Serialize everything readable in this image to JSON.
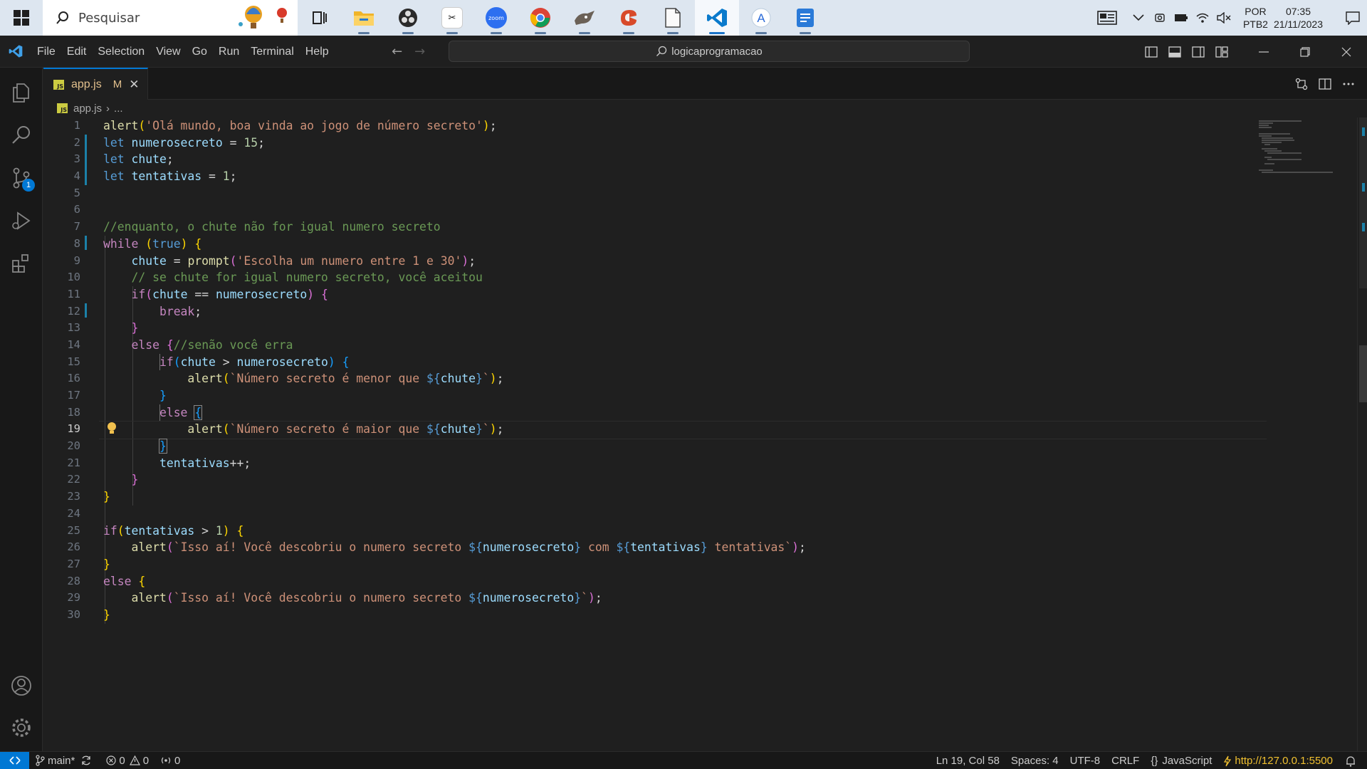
{
  "taskbar": {
    "search_placeholder": "Pesquisar",
    "apps": [
      {
        "name": "task-view",
        "running": false
      },
      {
        "name": "file-explorer",
        "running": true
      },
      {
        "name": "obs",
        "running": true
      },
      {
        "name": "capcut",
        "running": true
      },
      {
        "name": "zoom",
        "label": "zoom",
        "running": true
      },
      {
        "name": "chrome",
        "running": true
      },
      {
        "name": "gimp",
        "running": true
      },
      {
        "name": "scratch",
        "running": true
      },
      {
        "name": "notepad",
        "running": true
      },
      {
        "name": "vscode",
        "running": true,
        "active": true
      },
      {
        "name": "app-a",
        "running": true
      },
      {
        "name": "app-blue",
        "running": true
      }
    ],
    "tray": {
      "lang_line1": "POR",
      "lang_line2": "PTB2",
      "time": "07:35",
      "date": "21/11/2023"
    }
  },
  "titlebar": {
    "menus": [
      "File",
      "Edit",
      "Selection",
      "View",
      "Go",
      "Run",
      "Terminal",
      "Help"
    ],
    "command_center": "logicaprogramacao"
  },
  "activitybar": {
    "scm_badge": "1"
  },
  "tab": {
    "filename": "app.js",
    "status": "M",
    "icon_label": "JS"
  },
  "breadcrumb": {
    "file": "app.js",
    "more": "..."
  },
  "editor": {
    "current_line": 19,
    "line_numbers": [
      "1",
      "2",
      "3",
      "4",
      "5",
      "6",
      "7",
      "8",
      "9",
      "10",
      "11",
      "12",
      "13",
      "14",
      "15",
      "16",
      "17",
      "18",
      "19",
      "20",
      "21",
      "22",
      "23",
      "24",
      "25",
      "26",
      "27",
      "28",
      "29",
      "30"
    ],
    "tokens": {
      "l1_f": "alert",
      "l1_s": "'Olá mundo, boa vinda ao jogo de número secreto'",
      "l2_k": "let",
      "l2_v": "numerosecreto",
      "l2_n": "15",
      "l3_k": "let",
      "l3_v": "chute",
      "l4_k": "let",
      "l4_v": "tentativas",
      "l4_n": "1",
      "l7_c": "//enquanto, o chute não for igual numero secreto",
      "l8_k": "while",
      "l8_t": "true",
      "l9_v": "chute",
      "l9_f": "prompt",
      "l9_s": "'Escolha um numero entre 1 e 30'",
      "l10_c": "// se chute for igual numero secreto, você aceitou",
      "l11_k": "if",
      "l11_v1": "chute",
      "l11_v2": "numerosecreto",
      "l12_k": "break",
      "l14_k": "else",
      "l14_c": "//senão você erra",
      "l15_k": "if",
      "l15_v1": "chute",
      "l15_v2": "numerosecreto",
      "l16_f": "alert",
      "l16_s": "`Número secreto é menor que ",
      "l16_v": "chute",
      "l18_k": "else",
      "l19_f": "alert",
      "l19_s": "`Número secreto é maior que ",
      "l19_v": "chute",
      "l21_v": "tentativas",
      "l25_k": "if",
      "l25_v": "tentativas",
      "l25_n": "1",
      "l26_f": "alert",
      "l26_s1": "`Isso aí! Você descobriu o numero secreto ",
      "l26_v1": "numerosecreto",
      "l26_s2": " com ",
      "l26_v2": "tentativas",
      "l26_s3": " tentativas`",
      "l28_k": "else",
      "l29_f": "alert",
      "l29_s": "`Isso aí! Você descobriu o numero secreto ",
      "l29_v": "numerosecreto"
    }
  },
  "statusbar": {
    "branch": "main*",
    "errors": "0",
    "warnings": "0",
    "ports": "0",
    "cursor": "Ln 19, Col 58",
    "spaces": "Spaces: 4",
    "encoding": "UTF-8",
    "eol": "CRLF",
    "language": "JavaScript",
    "live_server": "http://127.0.0.1:5500"
  },
  "colors": {
    "accent": "#0078d4",
    "keyword": "#569cd6",
    "control": "#c586c0",
    "function": "#dcdcaa",
    "variable": "#9cdcfe",
    "string": "#ce9178",
    "number": "#b5cea8",
    "comment": "#6a9955",
    "modified": "#e2c08d"
  }
}
